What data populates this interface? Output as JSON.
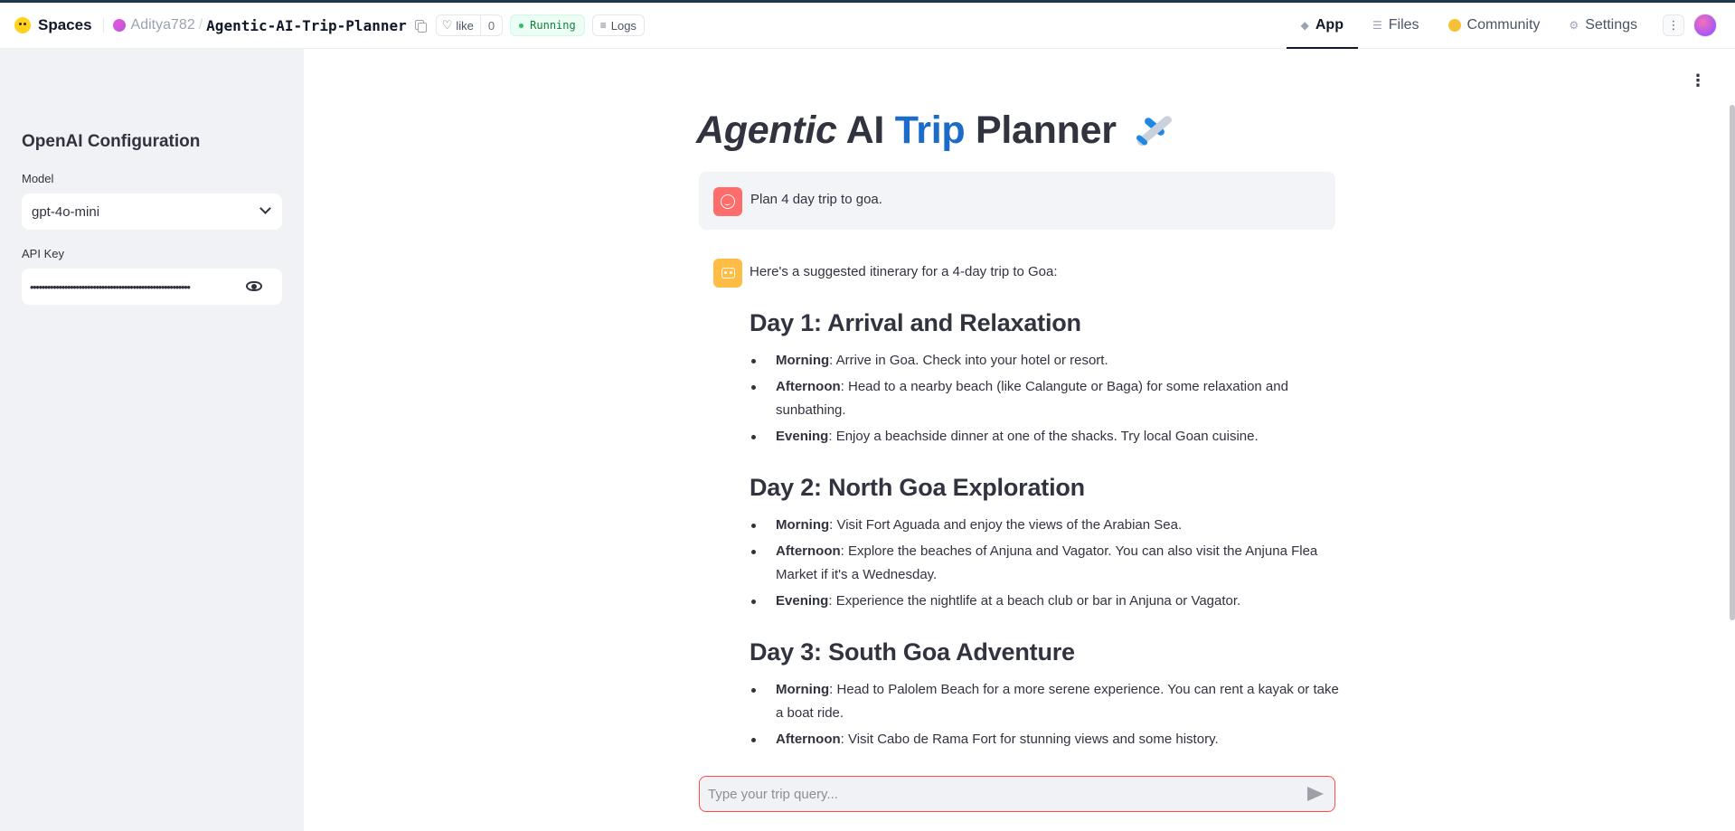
{
  "header": {
    "brand": "Spaces",
    "owner": "Aditya782",
    "separator": "/",
    "repo": "Agentic-AI-Trip-Planner",
    "like_label": "like",
    "like_count": "0",
    "status": "Running",
    "logs_label": "Logs",
    "tabs": [
      {
        "label": "App",
        "icon": "cube-icon",
        "active": true
      },
      {
        "label": "Files",
        "icon": "files-icon",
        "active": false
      },
      {
        "label": "Community",
        "icon": "community-icon",
        "active": false
      },
      {
        "label": "Settings",
        "icon": "gear-icon",
        "active": false
      }
    ]
  },
  "sidebar": {
    "title": "OpenAI Configuration",
    "model_label": "Model",
    "model_value": "gpt-4o-mini",
    "api_label": "API Key",
    "api_value": "••••••••••••••••••••••••••••••••••••••••••••••••••••••••"
  },
  "main": {
    "title_italic": "Agentic",
    "title_ai": "AI",
    "title_trip": "Trip",
    "title_planner": "Planner",
    "title_color_accent": "#1c6bc9",
    "user_message": "Plan 4 day trip to goa.",
    "assistant_intro": "Here's a suggested itinerary for a 4-day trip to Goa:",
    "days": [
      {
        "heading": "Day 1: Arrival and Relaxation",
        "items": [
          {
            "label": "Morning",
            "text": ": Arrive in Goa. Check into your hotel or resort."
          },
          {
            "label": "Afternoon",
            "text": ": Head to a nearby beach (like Calangute or Baga) for some relaxation and sunbathing."
          },
          {
            "label": "Evening",
            "text": ": Enjoy a beachside dinner at one of the shacks. Try local Goan cuisine."
          }
        ]
      },
      {
        "heading": "Day 2: North Goa Exploration",
        "items": [
          {
            "label": "Morning",
            "text": ": Visit Fort Aguada and enjoy the views of the Arabian Sea."
          },
          {
            "label": "Afternoon",
            "text": ": Explore the beaches of Anjuna and Vagator. You can also visit the Anjuna Flea Market if it's a Wednesday."
          },
          {
            "label": "Evening",
            "text": ": Experience the nightlife at a beach club or bar in Anjuna or Vagator."
          }
        ]
      },
      {
        "heading": "Day 3: South Goa Adventure",
        "items": [
          {
            "label": "Morning",
            "text": ": Head to Palolem Beach for a more serene experience. You can rent a kayak or take a boat ride."
          },
          {
            "label": "Afternoon",
            "text": ": Visit Cabo de Rama Fort for stunning views and some history."
          }
        ]
      }
    ],
    "chat_placeholder": "Type your trip query..."
  },
  "colors": {
    "sidebar_bg": "#f0f2f6",
    "user_avatar": "#ff6c6c",
    "assistant_avatar": "#ffbd45",
    "chat_border": "#ff4b4b",
    "status_green": "#15803d"
  }
}
